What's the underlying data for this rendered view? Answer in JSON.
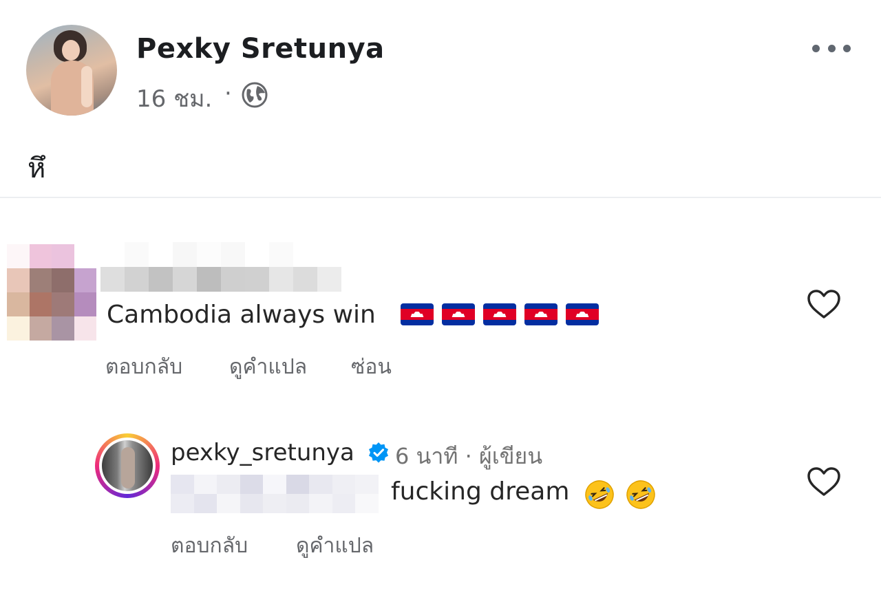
{
  "post": {
    "author": "Pexky Sretunya",
    "time": "16 ชม.",
    "separator": "·",
    "privacy_icon": "globe-icon",
    "text": "หึ",
    "more_icon": "more-options-icon"
  },
  "comment": {
    "text": "Cambodia always win",
    "emoji": [
      "cambodia-flag",
      "cambodia-flag",
      "cambodia-flag",
      "cambodia-flag",
      "cambodia-flag"
    ],
    "actions": {
      "reply": "ตอบกลับ",
      "translate": "ดูคำแปล",
      "hide": "ซ่อน"
    },
    "like_icon": "heart-icon"
  },
  "reply": {
    "username": "pexky_sretunya",
    "verified_icon": "verified-badge-icon",
    "time": "6 นาที",
    "separator": "·",
    "role": "ผู้เขียน",
    "text": "fucking dream",
    "emoji": [
      "rolling-on-floor-laughing",
      "rolling-on-floor-laughing"
    ],
    "actions": {
      "reply": "ตอบกลับ",
      "translate": "ดูคำแปล"
    },
    "like_icon": "heart-icon"
  },
  "colors": {
    "primary_text": "#1c1e21",
    "secondary_text": "#65676b",
    "verified_blue": "#0095f6",
    "divider": "#eceef1"
  }
}
